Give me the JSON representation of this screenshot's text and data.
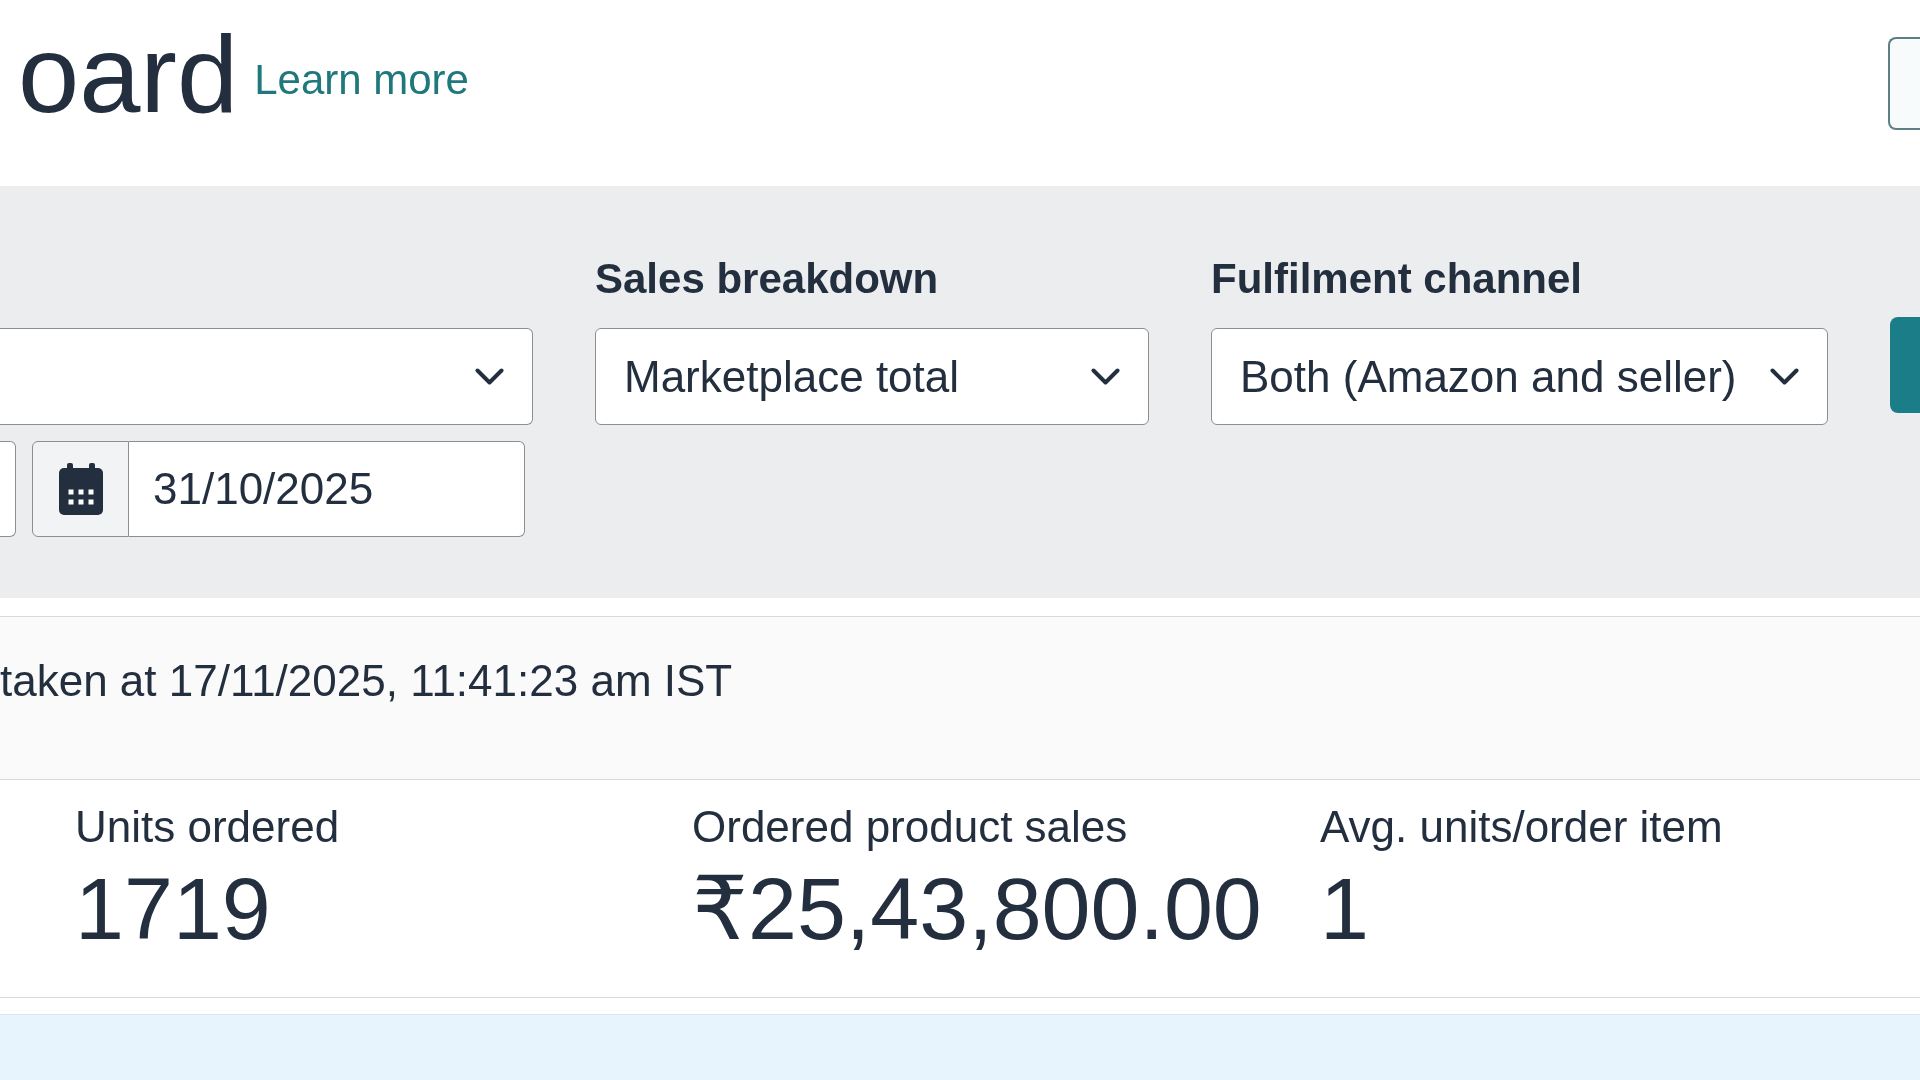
{
  "header": {
    "title": "oard",
    "link": "Learn more"
  },
  "filters": {
    "date_range": {
      "end_date": "31/10/2025"
    },
    "selects": [
      {
        "label": "Sales breakdown",
        "value": "Marketplace total"
      },
      {
        "label": "Fulfilment channel",
        "value": "Both (Amazon and seller)"
      }
    ]
  },
  "snapshot": {
    "text": "taken at 17/11/2025, 11:41:23 am IST"
  },
  "metrics": [
    {
      "label": "Units ordered",
      "value": "1719"
    },
    {
      "label": "Ordered product sales",
      "value": "₹25,43,800.00"
    },
    {
      "label": "Avg. units/order item",
      "value": "1"
    }
  ]
}
